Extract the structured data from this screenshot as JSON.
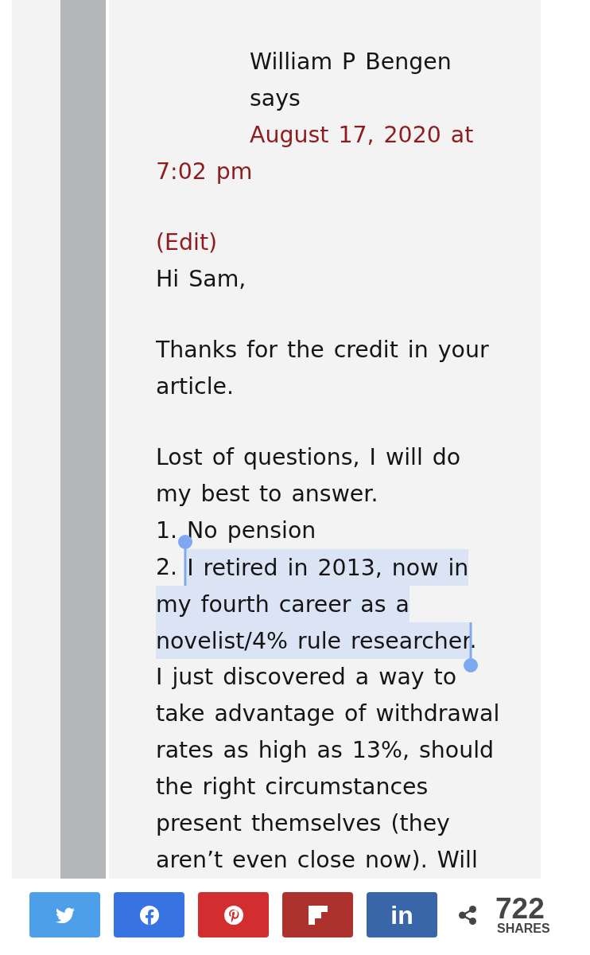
{
  "comment": {
    "author": "William P Bengen",
    "says": "says",
    "date": "August 17, 2020 at 7:02 pm",
    "edit": "(Edit)",
    "paragraphs": [
      {
        "lines": [
          {
            "segments": [
              {
                "text": "Hi Sam,",
                "selected": false
              }
            ]
          }
        ]
      },
      {
        "lines": [
          {
            "segments": [
              {
                "text": "Thanks for the credit in your article.",
                "selected": false
              }
            ]
          }
        ]
      },
      {
        "lines": [
          {
            "segments": [
              {
                "text": "Lost of questions, I will do my best to answer.",
                "selected": false
              }
            ]
          },
          {
            "segments": [
              {
                "text": "1. No pension",
                "selected": false
              }
            ]
          },
          {
            "segments": [
              {
                "text": "2. ",
                "selected": false
              },
              {
                "text": "I retired in 2013, now in my fourth career as a novelist/4% rule researcher",
                "selected": true
              },
              {
                "text": ".",
                "selected": false
              }
            ]
          },
          {
            "segments": [
              {
                "text": "I just discovered a way to take advantage of withdrawal rates as high as 13%, should the right circumstances present themselves (they aren’t even close now). Will",
                "selected": false
              }
            ]
          }
        ]
      }
    ]
  },
  "share_bar": {
    "buttons": [
      {
        "kind": "twitter",
        "color": "#4d9fea"
      },
      {
        "kind": "facebook",
        "color": "#3874e1"
      },
      {
        "kind": "pinterest",
        "color": "#d22e2f"
      },
      {
        "kind": "flipboard",
        "color": "#ad312c"
      },
      {
        "kind": "linkedin",
        "color": "#3966a9",
        "label": "in"
      }
    ],
    "count": "722",
    "count_label": "SHARES"
  }
}
